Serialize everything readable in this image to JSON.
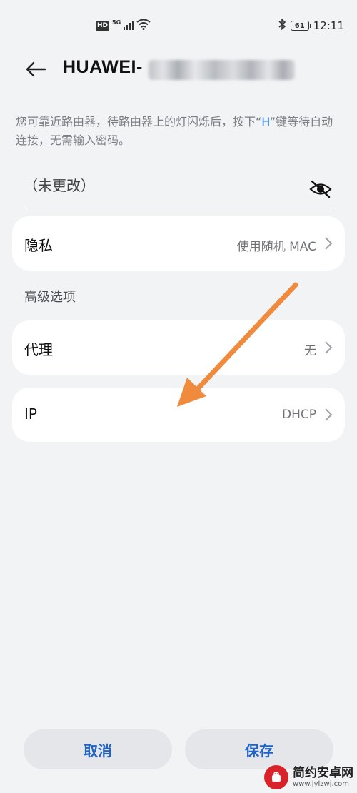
{
  "status_bar": {
    "hd": "HD",
    "network": "5G",
    "battery": "61",
    "time": "12:11"
  },
  "header": {
    "title": "HUAWEI-"
  },
  "hint": {
    "text_before": "您可靠近路由器，待路由器上的灯闪烁后，按下“",
    "key": "H",
    "text_after": "”键等待自动连接，无需输入密码。"
  },
  "password": {
    "value": "（未更改）"
  },
  "privacy": {
    "label": "隐私",
    "value": "使用随机 MAC"
  },
  "advanced": {
    "title": "高级选项"
  },
  "proxy": {
    "label": "代理",
    "value": "无"
  },
  "ip": {
    "label": "IP",
    "value": "DHCP"
  },
  "actions": {
    "cancel": "取消",
    "save": "保存"
  },
  "watermark": {
    "name": "简约安卓网",
    "url": "www.jylzwj.com"
  },
  "colors": {
    "accent": "#1f63c6",
    "arrow": "#f08a3c",
    "background": "#f1f3f5"
  }
}
